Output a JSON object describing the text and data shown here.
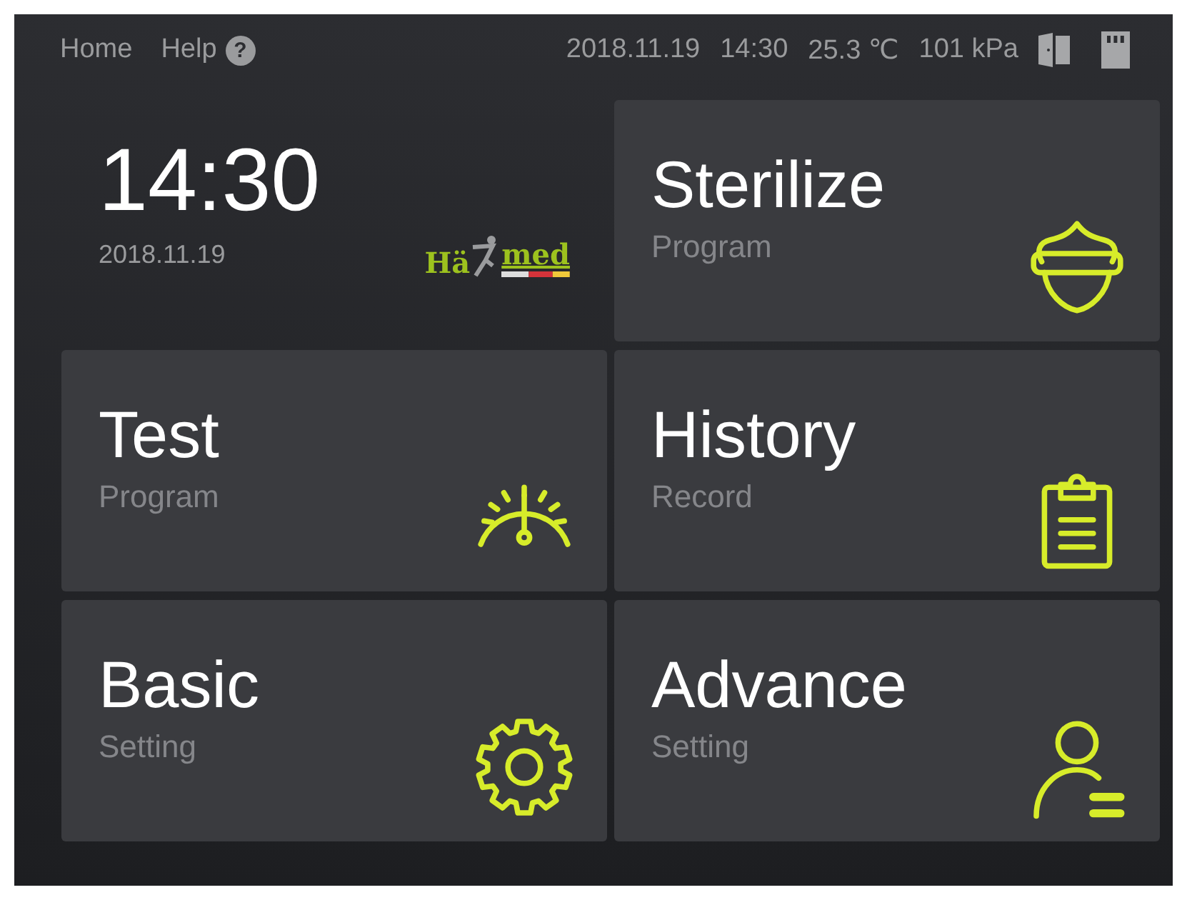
{
  "top_bar": {
    "nav": [
      {
        "label": "Home"
      },
      {
        "label": "Help",
        "help_icon": "?"
      }
    ],
    "date": "2018.11.19",
    "time": "14:30",
    "temperature": "25.3 ℃",
    "pressure": "101 kPa"
  },
  "clock": {
    "time": "14:30",
    "date": "2018.11.19"
  },
  "logo": {
    "left": "Hä",
    "right": "med"
  },
  "tiles": [
    {
      "kind": "shield",
      "title": "Sterilize",
      "subtitle": "Program"
    },
    {
      "kind": "gauge",
      "title": "Test",
      "subtitle": "Program"
    },
    {
      "kind": "clipboard",
      "title": "History",
      "subtitle": "Record"
    },
    {
      "kind": "gear",
      "title": "Basic",
      "subtitle": "Setting"
    },
    {
      "kind": "user",
      "title": "Advance",
      "subtitle": "Setting"
    }
  ]
}
